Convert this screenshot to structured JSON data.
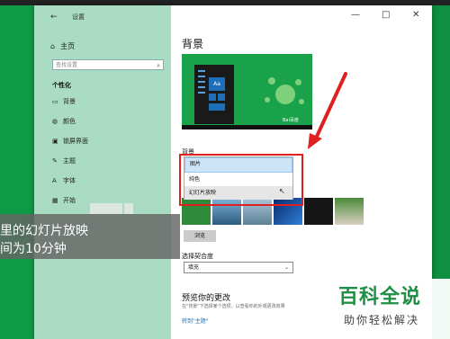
{
  "window": {
    "title": "设置",
    "controls": [
      "—",
      "□",
      "✕"
    ]
  },
  "sidebar": {
    "home": "主页",
    "search_placeholder": "查找设置",
    "section": "个性化",
    "items": [
      {
        "label": "背景",
        "icon": "picture-icon"
      },
      {
        "label": "颜色",
        "icon": "palette-icon"
      },
      {
        "label": "锁屏界面",
        "icon": "lockscreen-icon"
      },
      {
        "label": "主题",
        "icon": "theme-icon"
      },
      {
        "label": "字体",
        "icon": "font-icon"
      },
      {
        "label": "开始",
        "icon": "start-icon"
      }
    ]
  },
  "content": {
    "page_title": "背景",
    "preview_tile_text": "Aa",
    "preview_logo": "Bai百度",
    "background_label": "背景",
    "dropdown_options": [
      "图片",
      "纯色",
      "幻灯片放映"
    ],
    "dropdown_selected_index": 0,
    "browse_button": "浏览",
    "fit_label": "选择契合度",
    "fit_value": "填充",
    "preview_changes_title": "预览你的更改",
    "preview_changes_desc": "在\"背景\"下选择某个选项，以查看你的外观更改效果",
    "theme_link": "转到\"主题\""
  },
  "overlay": {
    "line1": "里的幻灯片放映",
    "line2": "间为10分钟"
  },
  "watermark": {
    "title": "百科全说",
    "subtitle": "助你轻松解决"
  },
  "colors": {
    "desktop_green": "#15a34f",
    "sidebar_bg": "#a9dcc2",
    "highlight_red": "#e02020",
    "accent_blue": "#1f6fb8"
  }
}
